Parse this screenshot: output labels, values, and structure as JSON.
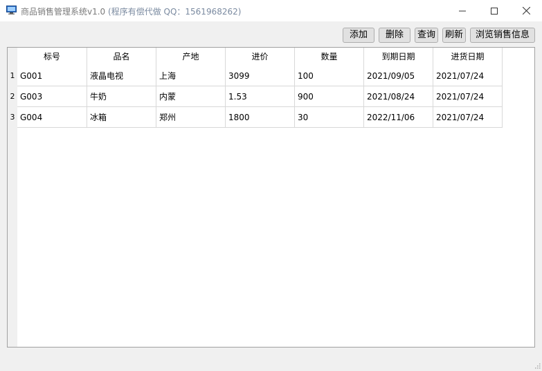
{
  "window": {
    "title": "商品销售管理系统v1.0",
    "title_suffix": "(程序有偿代做 QQ：1561968262)"
  },
  "toolbar": {
    "add_label": "添加",
    "delete_label": "删除",
    "query_label": "查询",
    "refresh_label": "刷新",
    "browse_label": "浏览销售信息"
  },
  "table": {
    "columns": [
      "标号",
      "品名",
      "产地",
      "进价",
      "数量",
      "到期日期",
      "进货日期"
    ],
    "rows": [
      {
        "num": "1",
        "cells": [
          "G001",
          "液晶电视",
          "上海",
          "3099",
          "100",
          "2021/09/05",
          "2021/07/24"
        ]
      },
      {
        "num": "2",
        "cells": [
          "G003",
          "牛奶",
          "内蒙",
          "1.53",
          "900",
          "2021/08/24",
          "2021/07/24"
        ]
      },
      {
        "num": "3",
        "cells": [
          "G004",
          "冰箱",
          "郑州",
          "1800",
          "30",
          "2022/11/06",
          "2021/07/24"
        ]
      }
    ]
  },
  "icons": {
    "app": "monitor-icon",
    "minimize": "minimize-icon",
    "maximize": "maximize-icon",
    "close": "close-icon"
  }
}
